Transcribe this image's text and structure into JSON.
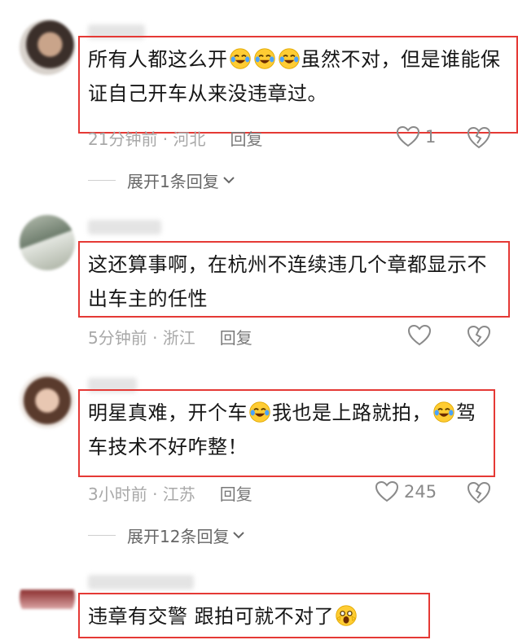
{
  "comments": [
    {
      "text_before": "所有人都这么开",
      "emoji_count": 3,
      "text_after": "虽然不对，但是谁能保证自己开车从来没违章过。",
      "time": "21分钟前 · 河北",
      "reply_label": "回复",
      "likes": "1",
      "expand_label": "展开1条回复"
    },
    {
      "text": "这还算事啊，在杭州不连续违几个章都显示不出车主的任性",
      "time": "5分钟前 · 浙江",
      "reply_label": "回复"
    },
    {
      "text_before": "明星真难，开个车",
      "text_middle": "我也是上路就拍，",
      "text_after": "驾车技术不好咋整！",
      "time": "3小时前 · 江苏",
      "reply_label": "回复",
      "likes": "245",
      "expand_label": "展开12条回复"
    },
    {
      "text": "违章有交警 跟拍可就不对了"
    }
  ],
  "colors": {
    "highlight_border": "#e53935",
    "text": "#161616",
    "meta": "#a8a8a8"
  },
  "icons": [
    "laughing-tears-emoji",
    "heart-outline-icon",
    "broken-heart-icon",
    "chevron-down-icon",
    "shocked-face-emoji"
  ]
}
